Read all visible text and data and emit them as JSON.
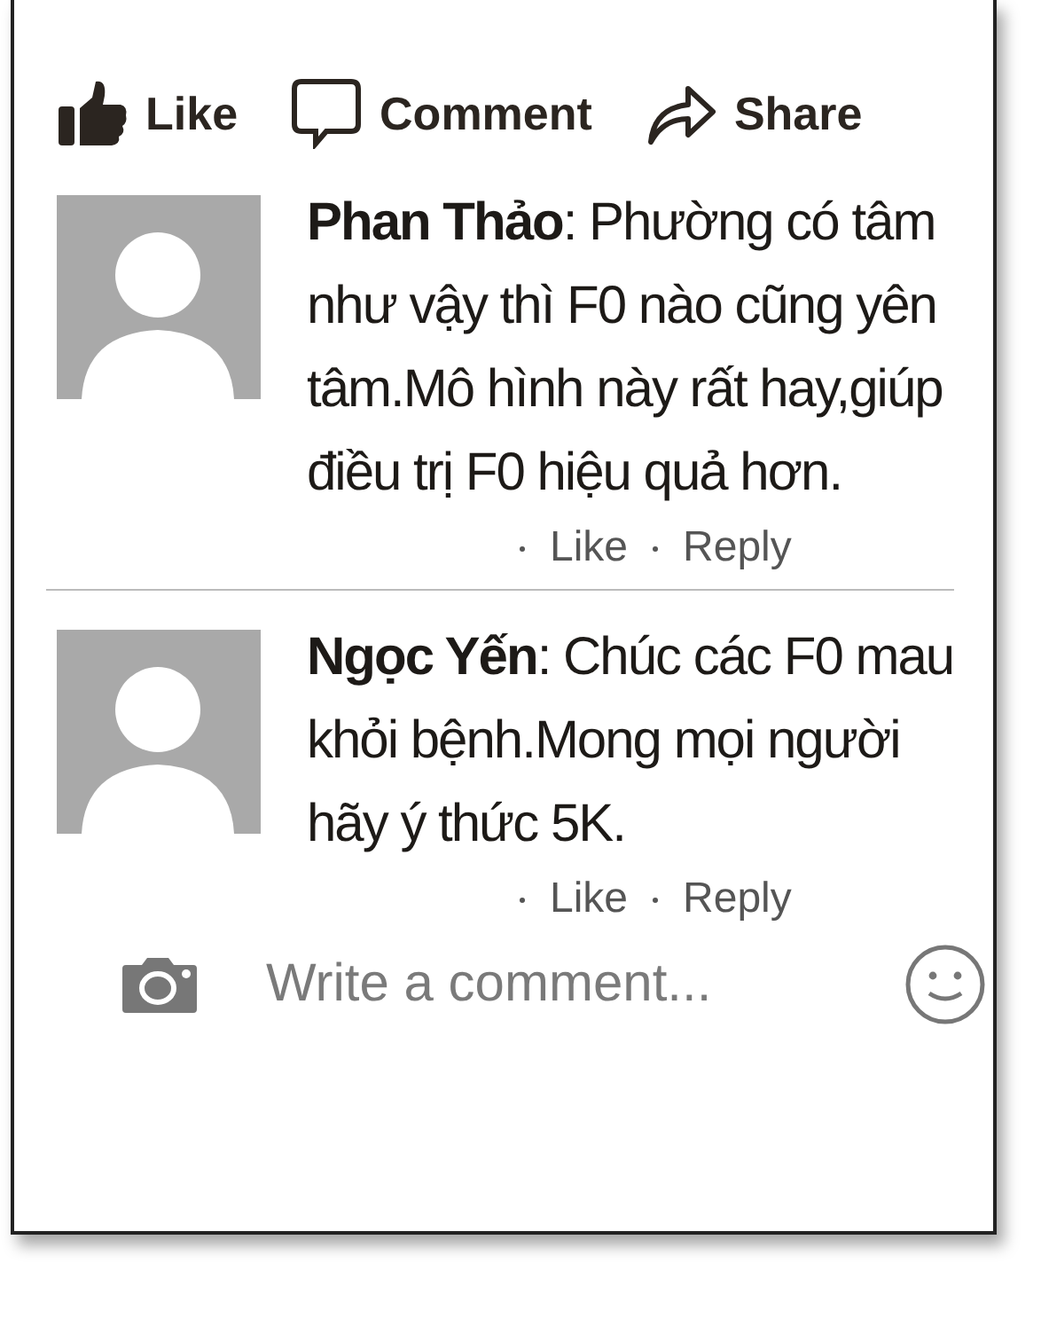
{
  "actions": [
    {
      "kind": "like",
      "label": "Like"
    },
    {
      "kind": "comment",
      "label": "Comment"
    },
    {
      "kind": "share",
      "label": "Share"
    }
  ],
  "comments": [
    {
      "text": "**Phan Thảo**: Phường có tâm như vậy thì F0 nào cũng yên tâm.Mô hình này rất hay,giúp điều trị F0 hiệu quả hơn.",
      "like": "Like",
      "reply": "Reply"
    },
    {
      "text": "**Ngọc Yến**: Chúc các F0 mau khỏi bệnh.Mong mọi người hãy ý thức 5K.",
      "like": "Like",
      "reply": "Reply"
    }
  ],
  "composer": {
    "placeholder": "Write a comment..."
  }
}
